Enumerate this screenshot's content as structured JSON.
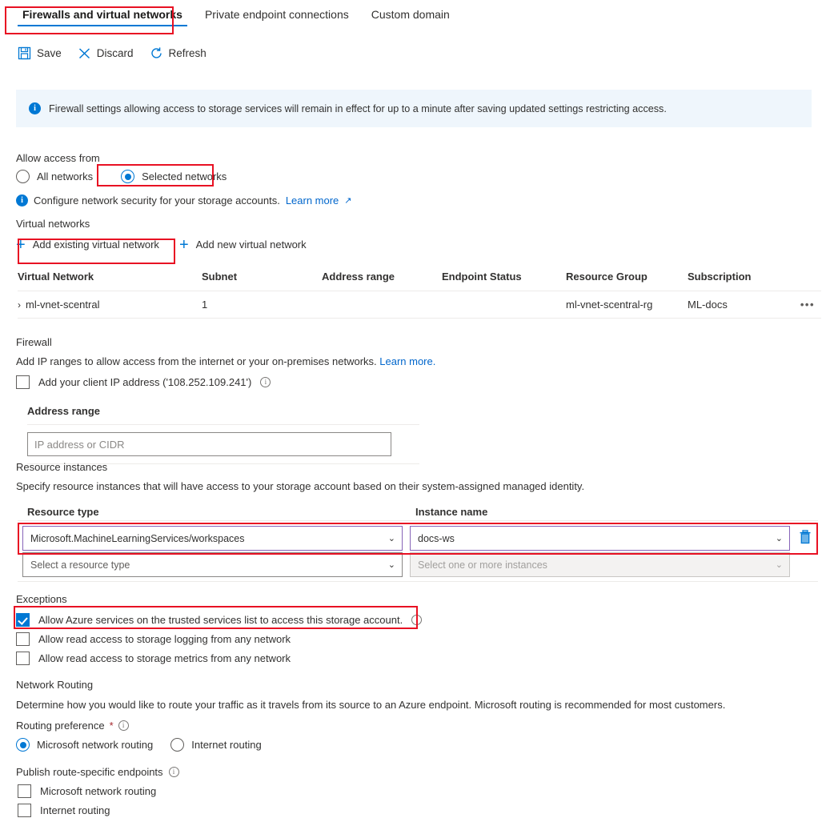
{
  "tabs": [
    {
      "label": "Firewalls and virtual networks",
      "active": true
    },
    {
      "label": "Private endpoint connections",
      "active": false
    },
    {
      "label": "Custom domain",
      "active": false
    }
  ],
  "toolbar": {
    "save_label": "Save",
    "discard_label": "Discard",
    "refresh_label": "Refresh"
  },
  "banner": {
    "text": "Firewall settings allowing access to storage services will remain in effect for up to a minute after saving updated settings restricting access."
  },
  "allow_access": {
    "label": "Allow access from",
    "options": [
      {
        "label": "All networks",
        "selected": false
      },
      {
        "label": "Selected networks",
        "selected": true
      }
    ],
    "hint_text": "Configure network security for your storage accounts.",
    "hint_link": "Learn more"
  },
  "virtual_networks": {
    "section_label": "Virtual networks",
    "add_existing_label": "Add existing virtual network",
    "add_new_label": "Add new virtual network",
    "columns": [
      "Virtual Network",
      "Subnet",
      "Address range",
      "Endpoint Status",
      "Resource Group",
      "Subscription"
    ],
    "rows": [
      {
        "virtual_network": "ml-vnet-scentral",
        "subnet": "1",
        "address_range": "",
        "endpoint_status": "",
        "resource_group": "ml-vnet-scentral-rg",
        "subscription": "ML-docs",
        "more_actions": "•••"
      }
    ]
  },
  "firewall": {
    "section_label": "Firewall",
    "description": "Add IP ranges to allow access from the internet or your on-premises networks.",
    "description_link": "Learn more.",
    "client_ip_label": "Add your client IP address ('108.252.109.241')",
    "client_ip_checked": false,
    "address_range_label": "Address range",
    "address_range_placeholder": "IP address or CIDR",
    "address_range_value": ""
  },
  "resource_instances": {
    "section_label": "Resource instances",
    "description": "Specify resource instances that will have access to your storage account based on their system-assigned managed identity.",
    "col_resource_type": "Resource type",
    "col_instance_name": "Instance name",
    "rows": [
      {
        "resource_type": "Microsoft.MachineLearningServices/workspaces",
        "instance_name": "docs-ws",
        "filled": true,
        "delete_icon": "trash-icon"
      },
      {
        "resource_type": "Select a resource type",
        "instance_name": "Select one or more instances",
        "filled": false,
        "delete_icon": ""
      }
    ]
  },
  "exceptions": {
    "section_label": "Exceptions",
    "items": [
      {
        "label": "Allow Azure services on the trusted services list to access this storage account.",
        "checked": true,
        "info": true
      },
      {
        "label": "Allow read access to storage logging from any network",
        "checked": false,
        "info": false
      },
      {
        "label": "Allow read access to storage metrics from any network",
        "checked": false,
        "info": false
      }
    ]
  },
  "network_routing": {
    "section_label": "Network Routing",
    "description": "Determine how you would like to route your traffic as it travels from its source to an Azure endpoint. Microsoft routing is recommended for most customers.",
    "routing_preference_label": "Routing preference",
    "required_mark": "*",
    "options": [
      {
        "label": "Microsoft network routing",
        "selected": true
      },
      {
        "label": "Internet routing",
        "selected": false
      }
    ],
    "publish_label": "Publish route-specific endpoints",
    "publish_items": [
      {
        "label": "Microsoft network routing",
        "checked": false
      },
      {
        "label": "Internet routing",
        "checked": false
      }
    ]
  },
  "colors": {
    "accent": "#0078d4",
    "annotation": "#e81123",
    "link": "#0066cc",
    "filled_select_border": "#8764b8",
    "banner_bg": "#eff6fc"
  }
}
